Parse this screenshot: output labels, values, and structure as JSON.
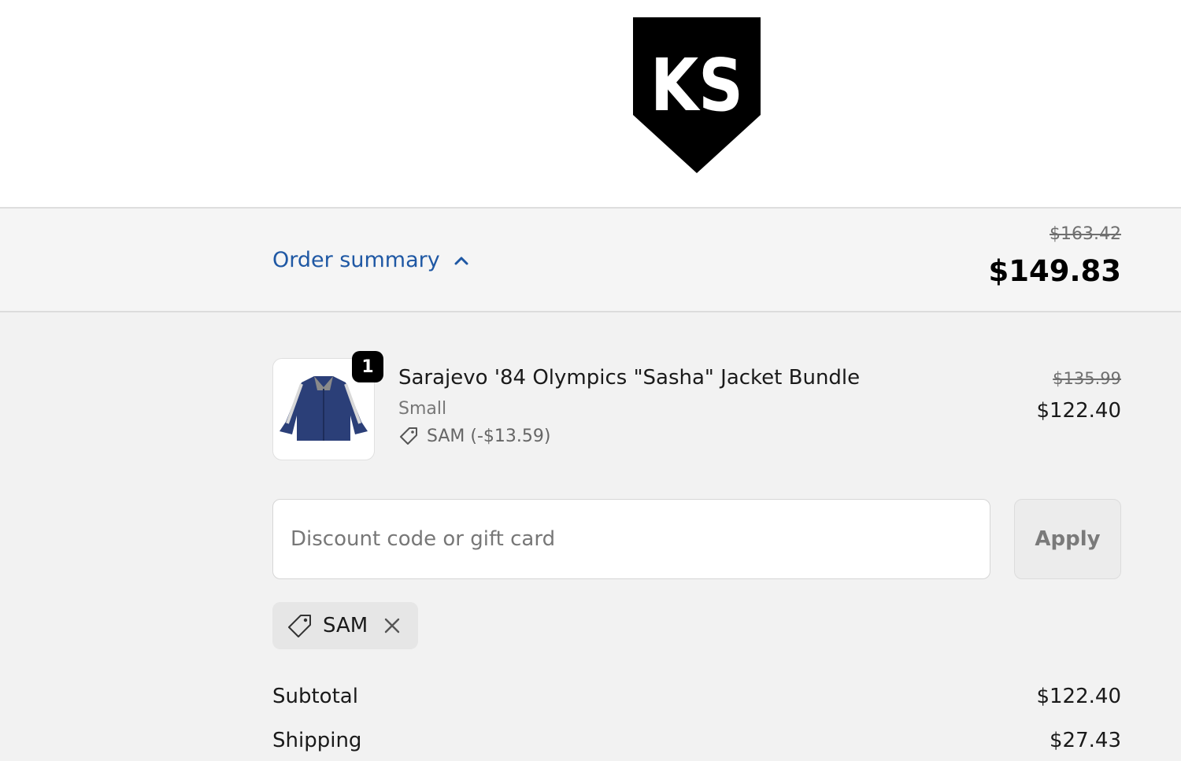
{
  "brand": {
    "logo_text": "KS"
  },
  "summary": {
    "toggle_label": "Order summary",
    "toggle_icon": "chevron-up-icon",
    "original_total": "$163.42",
    "total": "$149.83"
  },
  "product": {
    "quantity": "1",
    "name": "Sarajevo '84 Olympics \"Sasha\" Jacket Bundle",
    "variant": "Small",
    "discount": "SAM (-$13.59)",
    "original_price": "$135.99",
    "price": "$122.40"
  },
  "discount_form": {
    "placeholder": "Discount code or gift card",
    "value": "",
    "apply_label": "Apply"
  },
  "applied_code": {
    "code": "SAM"
  },
  "totals": {
    "subtotal_label": "Subtotal",
    "subtotal_value": "$122.40",
    "shipping_label": "Shipping",
    "shipping_value": "$27.43"
  },
  "colors": {
    "link": "#1f58a4",
    "background": "#f2f2f2"
  }
}
